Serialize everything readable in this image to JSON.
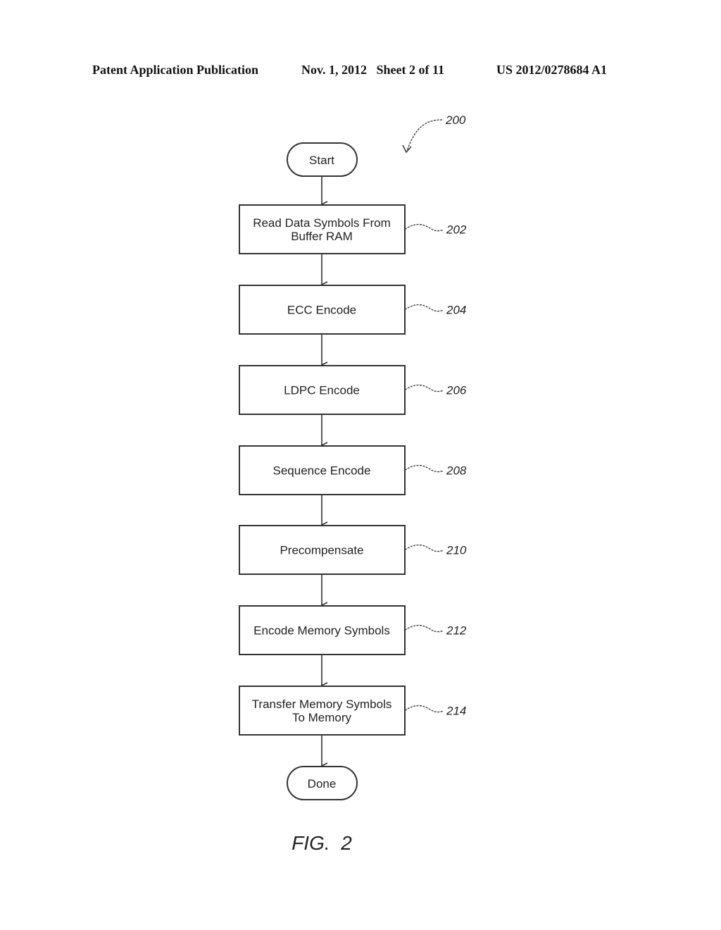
{
  "header": {
    "left": "Patent Application Publication",
    "middle": "Nov. 1, 2012   Sheet 2 of 11",
    "right": "US 2012/0278684 A1"
  },
  "diagram": {
    "ref": "200",
    "start": "Start",
    "end": "Done",
    "steps": [
      {
        "lines": [
          "Read Data Symbols From",
          "Buffer RAM"
        ],
        "ref": "202"
      },
      {
        "lines": [
          "ECC Encode"
        ],
        "ref": "204"
      },
      {
        "lines": [
          "LDPC Encode"
        ],
        "ref": "206"
      },
      {
        "lines": [
          "Sequence Encode"
        ],
        "ref": "208"
      },
      {
        "lines": [
          "Precompensate"
        ],
        "ref": "210"
      },
      {
        "lines": [
          "Encode Memory Symbols"
        ],
        "ref": "212"
      },
      {
        "lines": [
          "Transfer Memory Symbols",
          "To Memory"
        ],
        "ref": "214"
      }
    ],
    "figure_label": "FIG.  2"
  }
}
